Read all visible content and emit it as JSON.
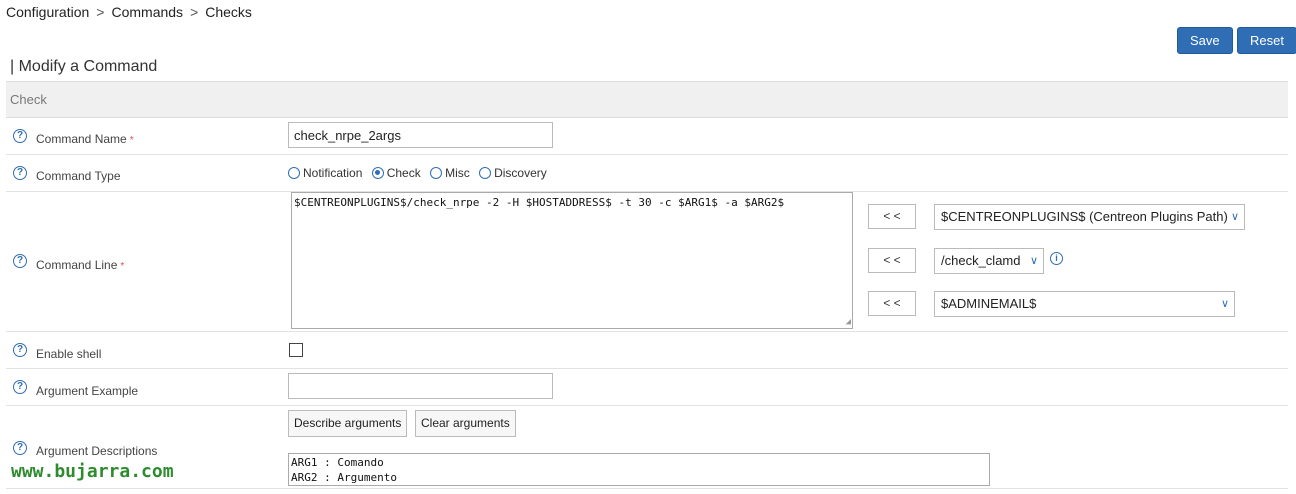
{
  "breadcrumb": [
    "Configuration",
    "Commands",
    "Checks"
  ],
  "breadcrumb_sep": ">",
  "actions": {
    "save": "Save",
    "reset": "Reset"
  },
  "page_title": "| Modify a Command",
  "section": "Check",
  "required_marker": "*",
  "fields": {
    "command_name": {
      "label": "Command Name",
      "value": "check_nrpe_2args"
    },
    "command_type": {
      "label": "Command Type",
      "options": [
        "Notification",
        "Check",
        "Misc",
        "Discovery"
      ],
      "selected": "Check"
    },
    "command_line": {
      "label": "Command Line",
      "value": "$CENTREONPLUGINS$/check_nrpe -2 -H $HOSTADDRESS$ -t 30 -c $ARG1$ -a $ARG2$",
      "insert_button": "< <",
      "selects": [
        "$CENTREONPLUGINS$ (Centreon Plugins Path)",
        "/check_clamd",
        "$ADMINEMAIL$"
      ]
    },
    "enable_shell": {
      "label": "Enable shell",
      "checked": false
    },
    "argument_example": {
      "label": "Argument Example",
      "value": ""
    },
    "argument_descriptions": {
      "label": "Argument Descriptions",
      "describe_button": "Describe arguments",
      "clear_button": "Clear arguments",
      "value": "ARG1 : Comando\nARG2 : Argumento"
    }
  },
  "watermark": "www.bujarra.com",
  "colors": {
    "accent": "#2f6db5",
    "watermark": "#2e8b2e",
    "required": "#d9534f"
  }
}
